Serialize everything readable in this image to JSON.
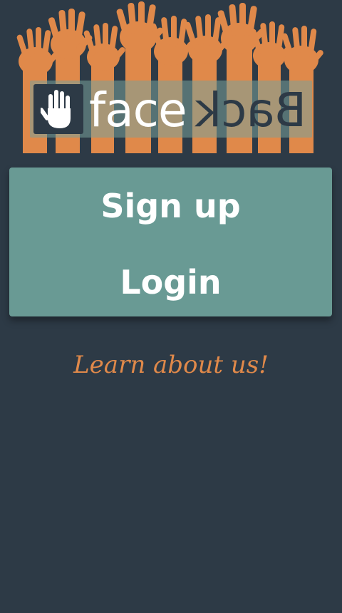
{
  "logo": {
    "word_face": "face",
    "word_back": "Back",
    "icon": "hand-icon",
    "art": "raised-hands-illustration"
  },
  "auth": {
    "signup_label": "Sign up",
    "login_label": "Login"
  },
  "learn": {
    "label": "Learn about us!"
  },
  "colors": {
    "background": "#2d3a46",
    "panel": "#699a94",
    "accent": "#e0894a",
    "text": "#ffffff"
  }
}
